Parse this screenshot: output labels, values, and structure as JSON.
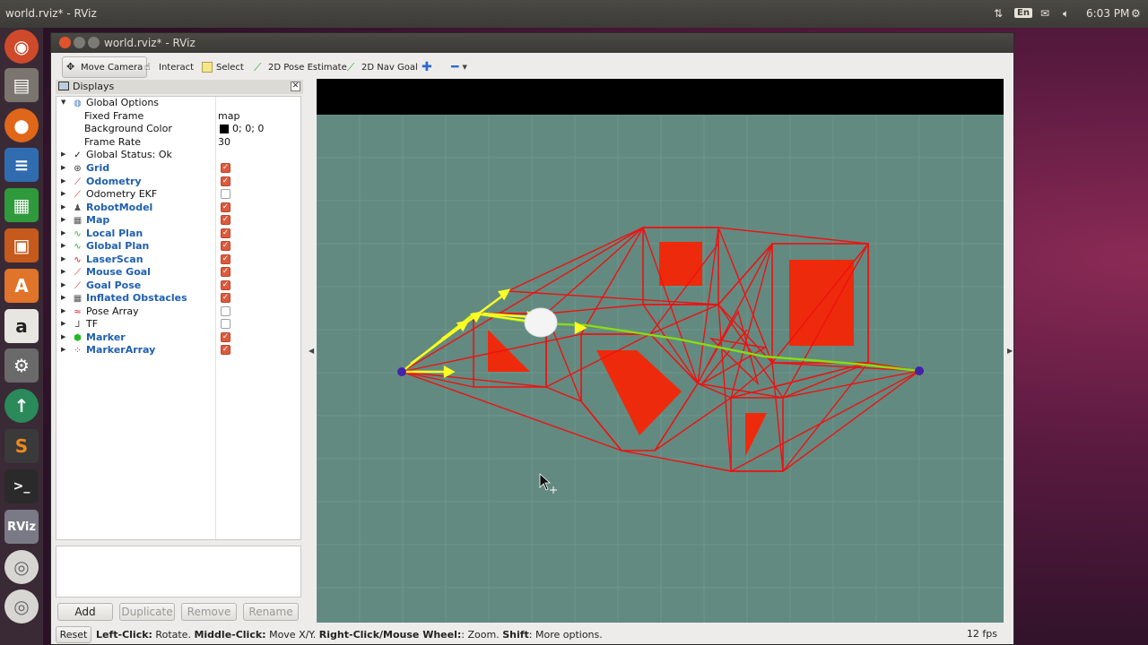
{
  "desktop": {
    "panel_title": "world.rviz* - RViz",
    "keyboard_layout": "En",
    "clock": "6:03 PM"
  },
  "launcher": {
    "items": [
      "ubuntu-dash-icon",
      "files-icon",
      "firefox-icon",
      "writer-icon",
      "calc-icon",
      "impress-icon",
      "software-center-icon",
      "amazon-icon",
      "system-settings-icon",
      "software-updater-icon",
      "sublime-icon",
      "terminal-icon",
      "rviz-icon",
      "disc-icon",
      "disc-icon"
    ],
    "rviz_label": "RViz"
  },
  "window": {
    "title": "world.rviz* - RViz"
  },
  "toolbar": {
    "move_camera": "Move Camera",
    "interact": "Interact",
    "select": "Select",
    "pose_estimate": "2D Pose Estimate",
    "nav_goal": "2D Nav Goal"
  },
  "displays": {
    "title": "Displays",
    "global_options": {
      "label": "Global Options",
      "fixed_frame_label": "Fixed Frame",
      "fixed_frame_value": "map",
      "bg_color_label": "Background Color",
      "bg_color_value": "0; 0; 0",
      "frame_rate_label": "Frame Rate",
      "frame_rate_value": "30"
    },
    "global_status": "Global Status: Ok",
    "items": [
      {
        "label": "Grid",
        "enabled": true,
        "color": "#333"
      },
      {
        "label": "Odometry",
        "enabled": true,
        "color": "#cc2222"
      },
      {
        "label": "Odometry EKF",
        "enabled": false,
        "color": "#cc2222"
      },
      {
        "label": "RobotModel",
        "enabled": true,
        "color": "#555"
      },
      {
        "label": "Map",
        "enabled": true,
        "color": "#555"
      },
      {
        "label": "Local Plan",
        "enabled": true,
        "color": "#22bb22"
      },
      {
        "label": "Global Plan",
        "enabled": true,
        "color": "#22bb22"
      },
      {
        "label": "LaserScan",
        "enabled": true,
        "color": "#cc2222"
      },
      {
        "label": "Mouse Goal",
        "enabled": true,
        "color": "#cc2222"
      },
      {
        "label": "Goal Pose",
        "enabled": true,
        "color": "#cc2222"
      },
      {
        "label": "Inflated Obstacles",
        "enabled": true,
        "color": "#555"
      },
      {
        "label": "Pose Array",
        "enabled": false,
        "color": "#cc2222"
      },
      {
        "label": "TF",
        "enabled": false,
        "color": "#555"
      },
      {
        "label": "Marker",
        "enabled": true,
        "color": "#22bb22"
      },
      {
        "label": "MarkerArray",
        "enabled": true,
        "color": "#cc2222"
      }
    ],
    "buttons": {
      "add": "Add",
      "duplicate": "Duplicate",
      "remove": "Remove",
      "rename": "Rename"
    }
  },
  "statusbar": {
    "reset": "Reset",
    "hint_1": "Left-Click:",
    "hint_1_text": " Rotate. ",
    "hint_2": "Middle-Click:",
    "hint_2_text": " Move X/Y. ",
    "hint_3": "Right-Click/Mouse Wheel:",
    "hint_3_text": ": Zoom. ",
    "hint_4": "Shift",
    "hint_4_text": ": More options.",
    "fps": "12 fps"
  },
  "colors": {
    "viewport_bg": "#628a80",
    "obstacle": "#ee2a0c",
    "graph_edges": "#ee1111",
    "plan": "#88dd11",
    "arrows": "#ffff22",
    "node": "#4422aa"
  }
}
